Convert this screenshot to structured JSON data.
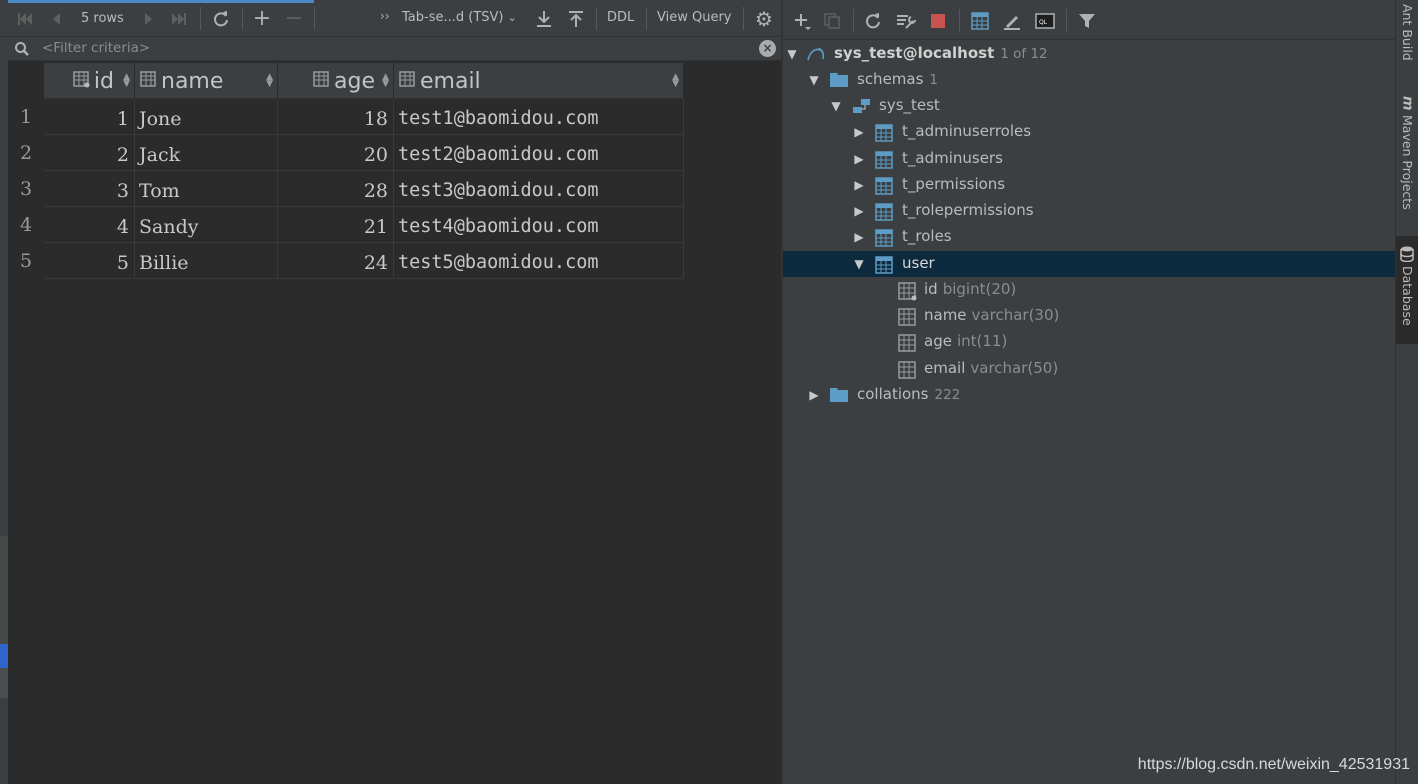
{
  "editor": {
    "rows_label": "5 rows",
    "export_format": "Tab-se...d (TSV)",
    "ddl_label": "DDL",
    "view_query_label": "View Query",
    "filter_placeholder": "<Filter criteria>",
    "columns": [
      {
        "label": "id"
      },
      {
        "label": "name"
      },
      {
        "label": "age"
      },
      {
        "label": "email"
      }
    ],
    "row_numbers": [
      "1",
      "2",
      "3",
      "4",
      "5"
    ],
    "rows": [
      {
        "id": "1",
        "name": "Jone",
        "age": "18",
        "email": "test1@baomidou.com"
      },
      {
        "id": "2",
        "name": "Jack",
        "age": "20",
        "email": "test2@baomidou.com"
      },
      {
        "id": "3",
        "name": "Tom",
        "age": "28",
        "email": "test3@baomidou.com"
      },
      {
        "id": "4",
        "name": "Sandy",
        "age": "21",
        "email": "test4@baomidou.com"
      },
      {
        "id": "5",
        "name": "Billie",
        "age": "24",
        "email": "test5@baomidou.com"
      }
    ]
  },
  "db": {
    "connection": {
      "name": "sys_test@localhost",
      "count": "1 of 12"
    },
    "schemas": {
      "label": "schemas",
      "count": "1"
    },
    "schema": {
      "label": "sys_test"
    },
    "tables": [
      "t_adminuserroles",
      "t_adminusers",
      "t_permissions",
      "t_rolepermissions",
      "t_roles"
    ],
    "user_table": {
      "label": "user"
    },
    "user_columns": [
      {
        "name": "id",
        "type": "bigint(20)"
      },
      {
        "name": "name",
        "type": "varchar(30)"
      },
      {
        "name": "age",
        "type": "int(11)"
      },
      {
        "name": "email",
        "type": "varchar(50)"
      }
    ],
    "collations": {
      "label": "collations",
      "count": "222"
    }
  },
  "side": {
    "ant_build": "Ant Build",
    "maven": "Maven Projects",
    "maven_icon": "m",
    "database": "Database"
  },
  "watermark": "https://blog.csdn.net/weixin_42531931",
  "colors": {
    "accent": "#4a88c7",
    "selection": "#0d293e",
    "stop": "#c75450",
    "folder": "#5d9cc4"
  }
}
